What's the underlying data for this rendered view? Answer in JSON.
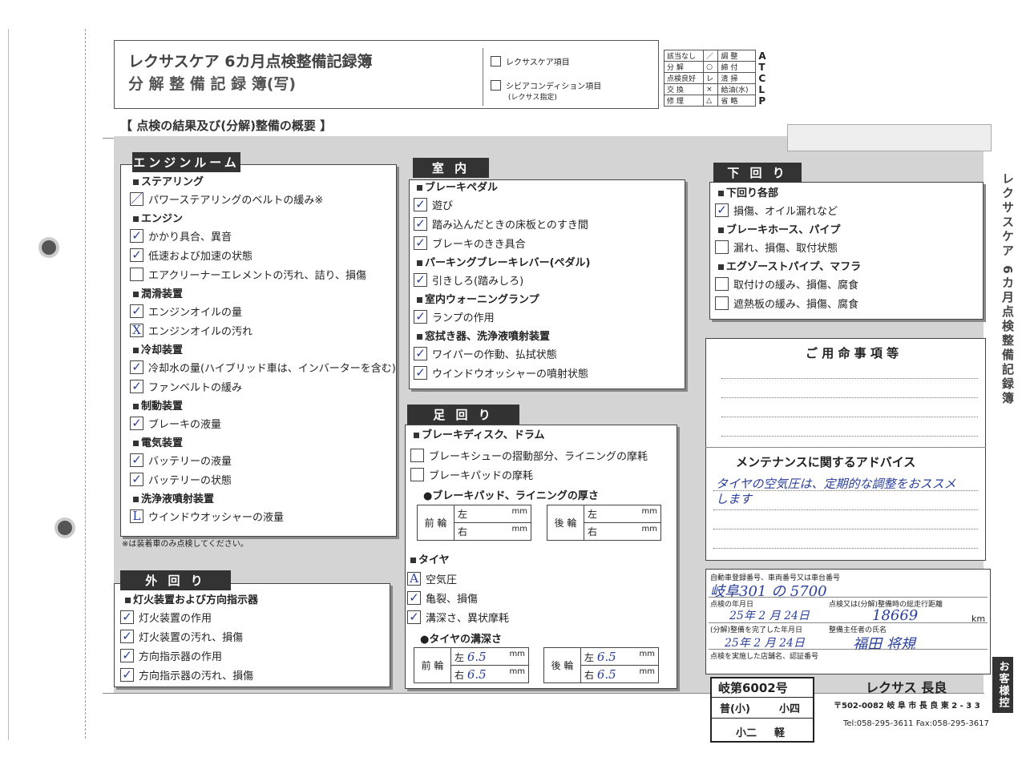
{
  "header": {
    "title1": "レクサスケア 6カ月点検整備記録簿",
    "title2": "分 解 整 備 記 録 簿(写)",
    "check1": "レクサスケア項目",
    "check2": "シビアコンディション項目",
    "check2_sub": "(レクサス指定)",
    "legend": [
      {
        "label": "該当なし",
        "sym": "／",
        "label2": "調 整",
        "code": "A"
      },
      {
        "label": "分 解",
        "sym": "○",
        "label2": "締 付",
        "code": "T"
      },
      {
        "label": "点検良好",
        "sym": "レ",
        "label2": "清 掃",
        "code": "C"
      },
      {
        "label": "交 換",
        "sym": "×",
        "label2": "給油(水)",
        "code": "L"
      },
      {
        "label": "修 理",
        "sym": "△",
        "label2": "省 略",
        "code": "P"
      }
    ]
  },
  "summary_title": "【 点検の結果及び(分解)整備の概要 】",
  "engine_room": {
    "title": "エンジンルーム",
    "groups": [
      {
        "name": "ステアリング",
        "items": [
          {
            "mark": "／",
            "text": "パワーステアリングのベルトの緩み※"
          }
        ]
      },
      {
        "name": "エンジン",
        "items": [
          {
            "mark": "✓",
            "text": "かかり具合、異音"
          },
          {
            "mark": "✓",
            "text": "低速および加速の状態"
          },
          {
            "mark": "",
            "text": "エアクリーナーエレメントの汚れ、詰り、損傷"
          }
        ]
      },
      {
        "name": "潤滑装置",
        "items": [
          {
            "mark": "✓",
            "text": "エンジンオイルの量"
          },
          {
            "mark": "X",
            "text": "エンジンオイルの汚れ"
          }
        ]
      },
      {
        "name": "冷却装置",
        "items": [
          {
            "mark": "✓",
            "text": "冷却水の量(ハイブリッド車は、インバーターを含む)"
          },
          {
            "mark": "✓",
            "text": "ファンベルトの緩み"
          }
        ]
      },
      {
        "name": "制動装置",
        "items": [
          {
            "mark": "✓",
            "text": "ブレーキの液量"
          }
        ]
      },
      {
        "name": "電気装置",
        "items": [
          {
            "mark": "✓",
            "text": "バッテリーの液量"
          },
          {
            "mark": "✓",
            "text": "バッテリーの状態"
          }
        ]
      },
      {
        "name": "洗浄液噴射装置",
        "items": [
          {
            "mark": "L",
            "text": "ウインドウオッシャーの液量"
          }
        ]
      }
    ],
    "note": "※は装着車のみ点検してください。"
  },
  "exterior": {
    "title": "外 回 り",
    "group": "灯火装置および方向指示器",
    "items": [
      {
        "mark": "✓",
        "text": "灯火装置の作用"
      },
      {
        "mark": "✓",
        "text": "灯火装置の汚れ、損傷"
      },
      {
        "mark": "✓",
        "text": "方向指示器の作用"
      },
      {
        "mark": "✓",
        "text": "方向指示器の汚れ、損傷"
      }
    ]
  },
  "interior": {
    "title": "室 内",
    "groups": [
      {
        "name": "ブレーキペダル",
        "items": [
          {
            "mark": "✓",
            "text": "遊び"
          },
          {
            "mark": "✓",
            "text": "踏み込んだときの床板とのすき間"
          },
          {
            "mark": "✓",
            "text": "ブレーキのきき具合"
          }
        ]
      },
      {
        "name": "パーキングブレーキレバー(ペダル)",
        "items": [
          {
            "mark": "✓",
            "text": "引きしろ(踏みしろ)"
          }
        ]
      },
      {
        "name": "室内ウォーニングランプ",
        "items": [
          {
            "mark": "✓",
            "text": "ランプの作用"
          }
        ]
      },
      {
        "name": "窓拭き器、洗浄液噴射装置",
        "items": [
          {
            "mark": "✓",
            "text": "ワイパーの作動、払拭状態"
          },
          {
            "mark": "✓",
            "text": "ウインドウオッシャーの噴射状態"
          }
        ]
      }
    ]
  },
  "chassis": {
    "title": "足 回 り",
    "group": "ブレーキディスク、ドラム",
    "items": [
      {
        "mark": "",
        "text": "ブレーキシューの摺動部分、ライニングの摩耗"
      },
      {
        "mark": "",
        "text": "ブレーキパッドの摩耗"
      }
    ],
    "pad_title": "●ブレーキパッド、ライニングの厚さ",
    "front": "前 輪",
    "rear": "後 輪",
    "left": "左",
    "right": "右",
    "unit": "mm",
    "tire_group": "タイヤ",
    "tire_items": [
      {
        "mark": "A",
        "text": "空気圧"
      },
      {
        "mark": "✓",
        "text": "亀裂、損傷"
      },
      {
        "mark": "✓",
        "text": "溝深さ、異状摩耗"
      }
    ],
    "tread_title": "●タイヤの溝深さ",
    "tread": {
      "front_left": "6.5",
      "front_right": "6.5",
      "rear_left": "6.5",
      "rear_right": "6.5"
    }
  },
  "underbody": {
    "title": "下 回 り",
    "groups": [
      {
        "name": "下回り各部",
        "items": [
          {
            "mark": "✓",
            "text": "損傷、オイル漏れなど"
          }
        ]
      },
      {
        "name": "ブレーキホース、パイプ",
        "items": [
          {
            "mark": "",
            "text": "漏れ、損傷、取付状態"
          }
        ]
      },
      {
        "name": "エグゾーストパイプ、マフラ",
        "items": [
          {
            "mark": "",
            "text": "取付けの緩み、損傷、腐食"
          },
          {
            "mark": "",
            "text": "遮熱板の緩み、損傷、腐食"
          }
        ]
      }
    ]
  },
  "notes": {
    "title": "ご 用 命 事 項 等",
    "advice_title": "メンテナンスに関するアドバイス",
    "advice_text1": "タイヤの空気圧は、定期的な調整をおススメ",
    "advice_text2": "します"
  },
  "vehicle": {
    "reg_label": "自動車登録番号、車両番号又は車台番号",
    "reg_value": "岐阜301 の 5700",
    "inspect_label": "点検の年月日",
    "inspect_date": "25年 2 月 24日",
    "distance_label": "点検又は(分解)整備時の総走行距離",
    "distance": "18669",
    "km": "km",
    "maint_label": "(分解)整備を完了した年月日",
    "maint_date": "25年 2 月 24日",
    "chief_label": "整備主任者の氏名",
    "chief_name": "福田 将規",
    "shop_label": "点検を実施した店舗名、認証番号",
    "cert1": "岐第6002号",
    "cert2a": "普(小)",
    "cert2b": "小四",
    "cert3a": "小二",
    "cert3b": "軽",
    "shop_name": "レクサス 長良",
    "address": "〒502-0082 岐 阜 市 長 良 東 2 - 3 3",
    "phone": "Tel:058-295-3611  Fax:058-295-3617"
  },
  "side": {
    "vertical_title": "レクサスケア 6カ月点検整備記録簿",
    "copy_label": "お客様控"
  }
}
